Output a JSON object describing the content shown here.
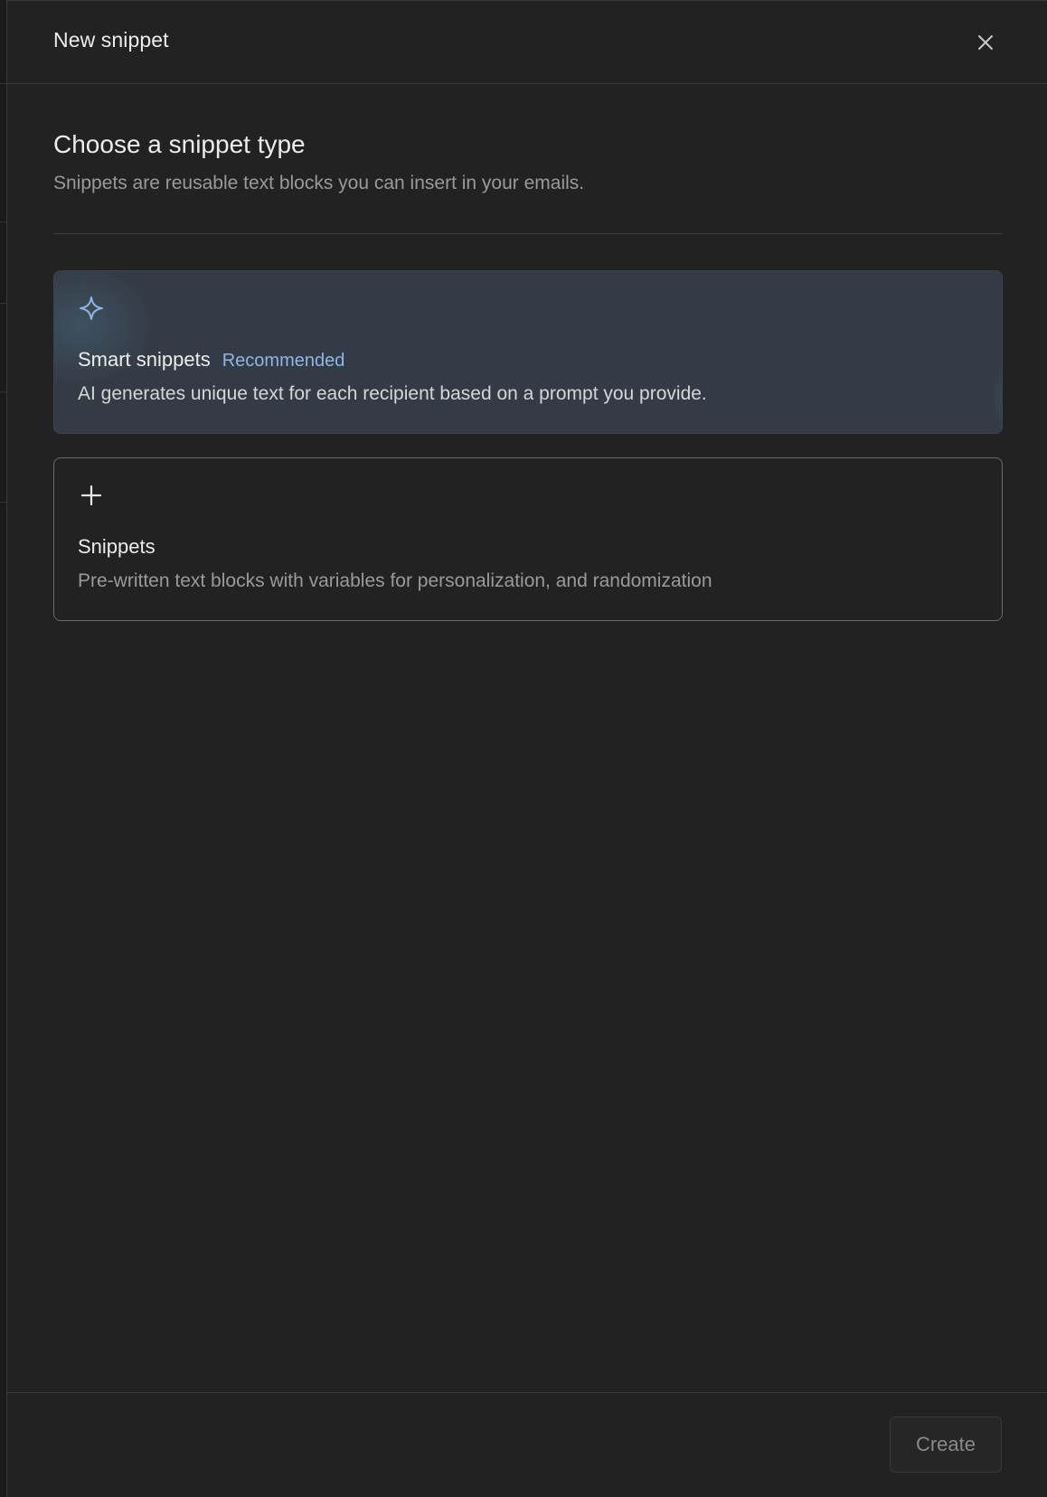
{
  "dialog": {
    "title": "New snippet",
    "close_icon": "close-icon"
  },
  "section": {
    "title": "Choose a snippet type",
    "subtitle": "Snippets are reusable text blocks you can insert in your emails."
  },
  "options": [
    {
      "icon": "sparkle-icon",
      "title": "Smart snippets",
      "badge": "Recommended",
      "description": "AI generates unique text for each recipient based on a prompt you provide."
    },
    {
      "icon": "plus-icon",
      "title": "Snippets",
      "description": "Pre-written text blocks with variables for personalization, and randomization"
    }
  ],
  "footer": {
    "create_label": "Create"
  },
  "colors": {
    "panel_bg": "#222222",
    "smart_card_bg": "#343b47",
    "accent": "#8fb6e6",
    "muted_text": "#9a9a9a"
  }
}
